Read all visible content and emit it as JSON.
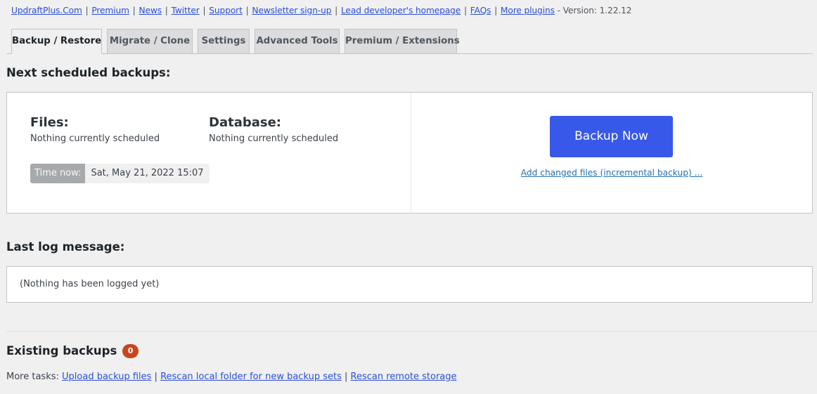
{
  "header_links": {
    "links": [
      "UpdraftPlus.Com",
      "Premium",
      "News",
      "Twitter",
      "Support",
      "Newsletter sign-up",
      "Lead developer's homepage",
      "FAQs",
      "More plugins"
    ],
    "separator": "|",
    "version_text": "- Version: 1.22.12"
  },
  "tabs": [
    {
      "label": "Backup / Restore",
      "active": true
    },
    {
      "label": "Migrate / Clone",
      "active": false
    },
    {
      "label": "Settings",
      "active": false
    },
    {
      "label": "Advanced Tools",
      "active": false
    },
    {
      "label": "Premium / Extensions",
      "active": false
    }
  ],
  "scheduled": {
    "heading": "Next scheduled backups:",
    "files_label": "Files:",
    "files_status": "Nothing currently scheduled",
    "database_label": "Database:",
    "database_status": "Nothing currently scheduled",
    "time_now_label": "Time now:",
    "time_now_value": "Sat, May 21, 2022 15:07",
    "backup_now_label": "Backup Now",
    "incremental_link": "Add changed files (incremental backup) ..."
  },
  "log": {
    "heading": "Last log message:",
    "message": "(Nothing has been logged yet)"
  },
  "existing": {
    "heading": "Existing backups",
    "count": "0",
    "more_tasks_label": "More tasks:",
    "tasks": [
      "Upload backup files",
      "Rescan local folder for new backup sets",
      "Rescan remote storage"
    ],
    "separator": "|"
  },
  "colors": {
    "primary_button": "#3858e9",
    "badge": "#c9461c",
    "link": "#2c4fd4",
    "background": "#f0f0f1"
  }
}
